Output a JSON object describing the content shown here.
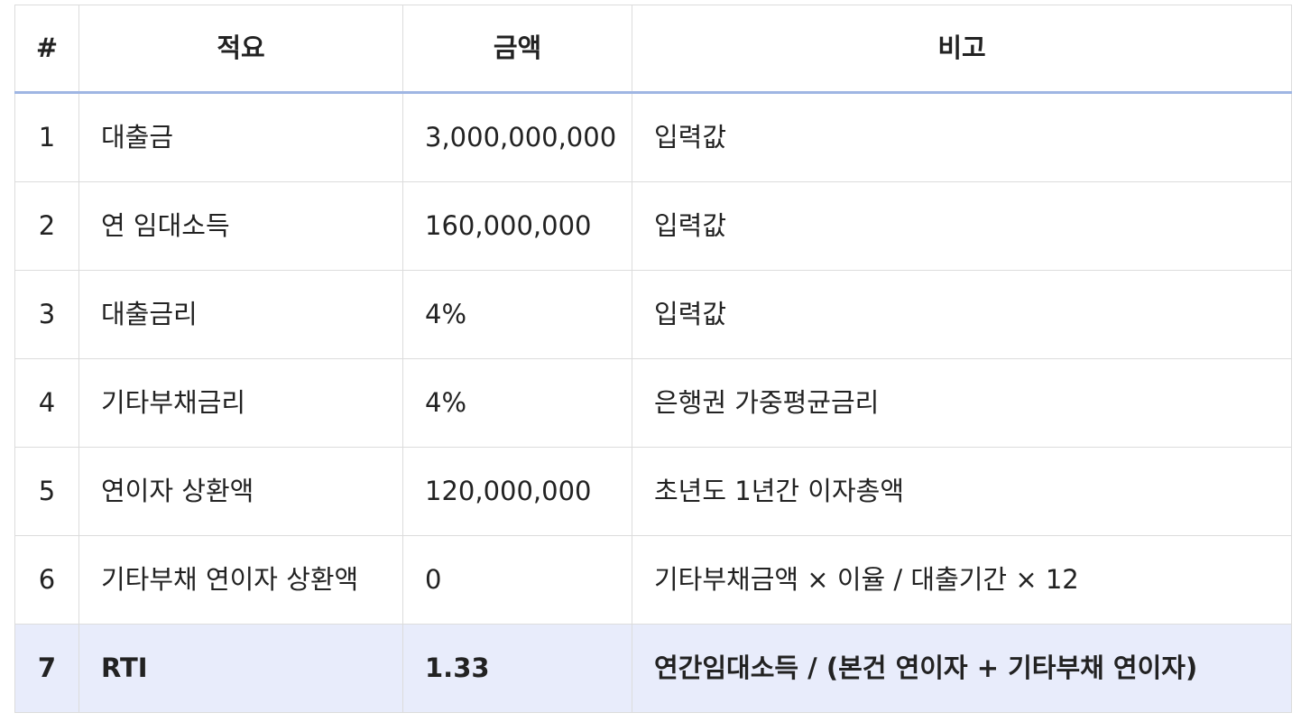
{
  "table": {
    "headers": [
      "#",
      "적요",
      "금액",
      "비고"
    ],
    "rows": [
      {
        "idx": "1",
        "desc": "대출금",
        "amount": "3,000,000,000",
        "note": "입력값"
      },
      {
        "idx": "2",
        "desc": "연 임대소득",
        "amount": "160,000,000",
        "note": "입력값"
      },
      {
        "idx": "3",
        "desc": "대출금리",
        "amount": "4%",
        "note": "입력값"
      },
      {
        "idx": "4",
        "desc": "기타부채금리",
        "amount": "4%",
        "note": "은행권 가중평균금리"
      },
      {
        "idx": "5",
        "desc": "연이자 상환액",
        "amount": "120,000,000",
        "note": "초년도 1년간 이자총액"
      },
      {
        "idx": "6",
        "desc": "기타부채 연이자 상환액",
        "amount": "0",
        "note": "기타부채금액 × 이율 / 대출기간 × 12"
      },
      {
        "idx": "7",
        "desc": "RTI",
        "amount": "1.33",
        "note": "연간임대소득 / (본건 연이자 + 기타부채 연이자)"
      }
    ],
    "colors": {
      "header_underline": "#9fb6e3",
      "highlight_row": "#e8ecfb",
      "grid_line": "#dcdcdc"
    }
  }
}
